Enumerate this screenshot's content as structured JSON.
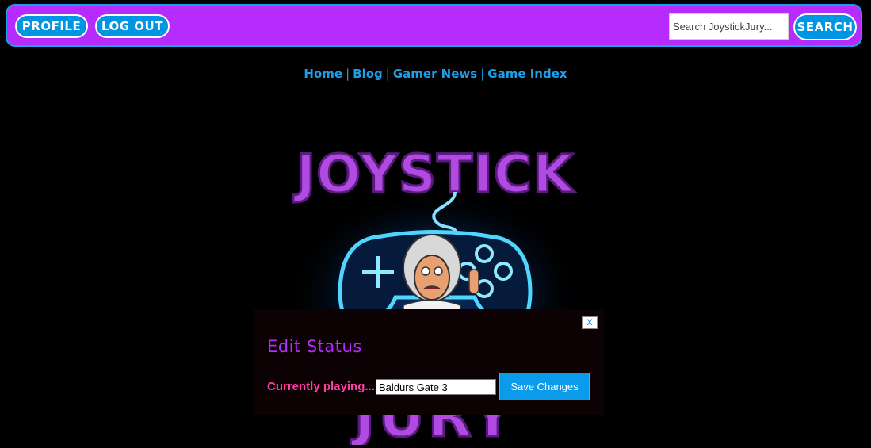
{
  "header": {
    "profile_label": "PROFILE",
    "logout_label": "LOG OUT",
    "search_placeholder": "Search JoystickJury...",
    "search_label": "SEARCH"
  },
  "nav": {
    "links": [
      "Home",
      "Blog",
      "Gamer News",
      "Game Index"
    ],
    "separator": "|"
  },
  "logo": {
    "top_text": "JOYSTICK",
    "bottom_text": "JURY"
  },
  "modal": {
    "close_label": "X",
    "title": "Edit Status",
    "status_label": "Currently playing...",
    "status_value": "Baldurs Gate 3",
    "save_label": "Save Changes"
  },
  "colors": {
    "brand_purple": "#b62cff",
    "accent_blue": "#0095e3",
    "status_pink": "#ff3fa4",
    "background": "#000000"
  }
}
